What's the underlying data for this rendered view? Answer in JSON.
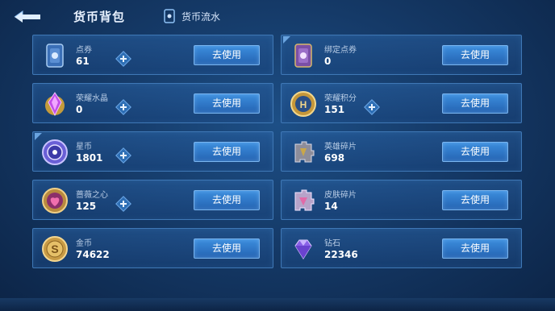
{
  "header": {
    "title": "货币背包",
    "flow_label": "货币流水"
  },
  "use_label": "去使用",
  "currencies": [
    {
      "name": "点券",
      "value": "61",
      "icon": "coupon-card-icon"
    },
    {
      "name": "绑定点券",
      "value": "0",
      "icon": "bound-coupon-card-icon"
    },
    {
      "name": "荣耀水晶",
      "value": "0",
      "icon": "glory-crystal-icon"
    },
    {
      "name": "荣耀积分",
      "value": "151",
      "icon": "glory-points-icon"
    },
    {
      "name": "星币",
      "value": "1801",
      "icon": "star-coin-icon"
    },
    {
      "name": "英雄碎片",
      "value": "698",
      "icon": "hero-fragment-icon"
    },
    {
      "name": "蔷薇之心",
      "value": "125",
      "icon": "rose-heart-icon"
    },
    {
      "name": "皮肤碎片",
      "value": "14",
      "icon": "skin-fragment-icon"
    },
    {
      "name": "金币",
      "value": "74622",
      "icon": "gold-coin-icon"
    },
    {
      "name": "钻石",
      "value": "22346",
      "icon": "diamond-icon"
    }
  ],
  "colors": {
    "background": "#153a68",
    "card_border": "#3f78b6",
    "button": "#2f79c8",
    "label": "#b9cde6"
  }
}
